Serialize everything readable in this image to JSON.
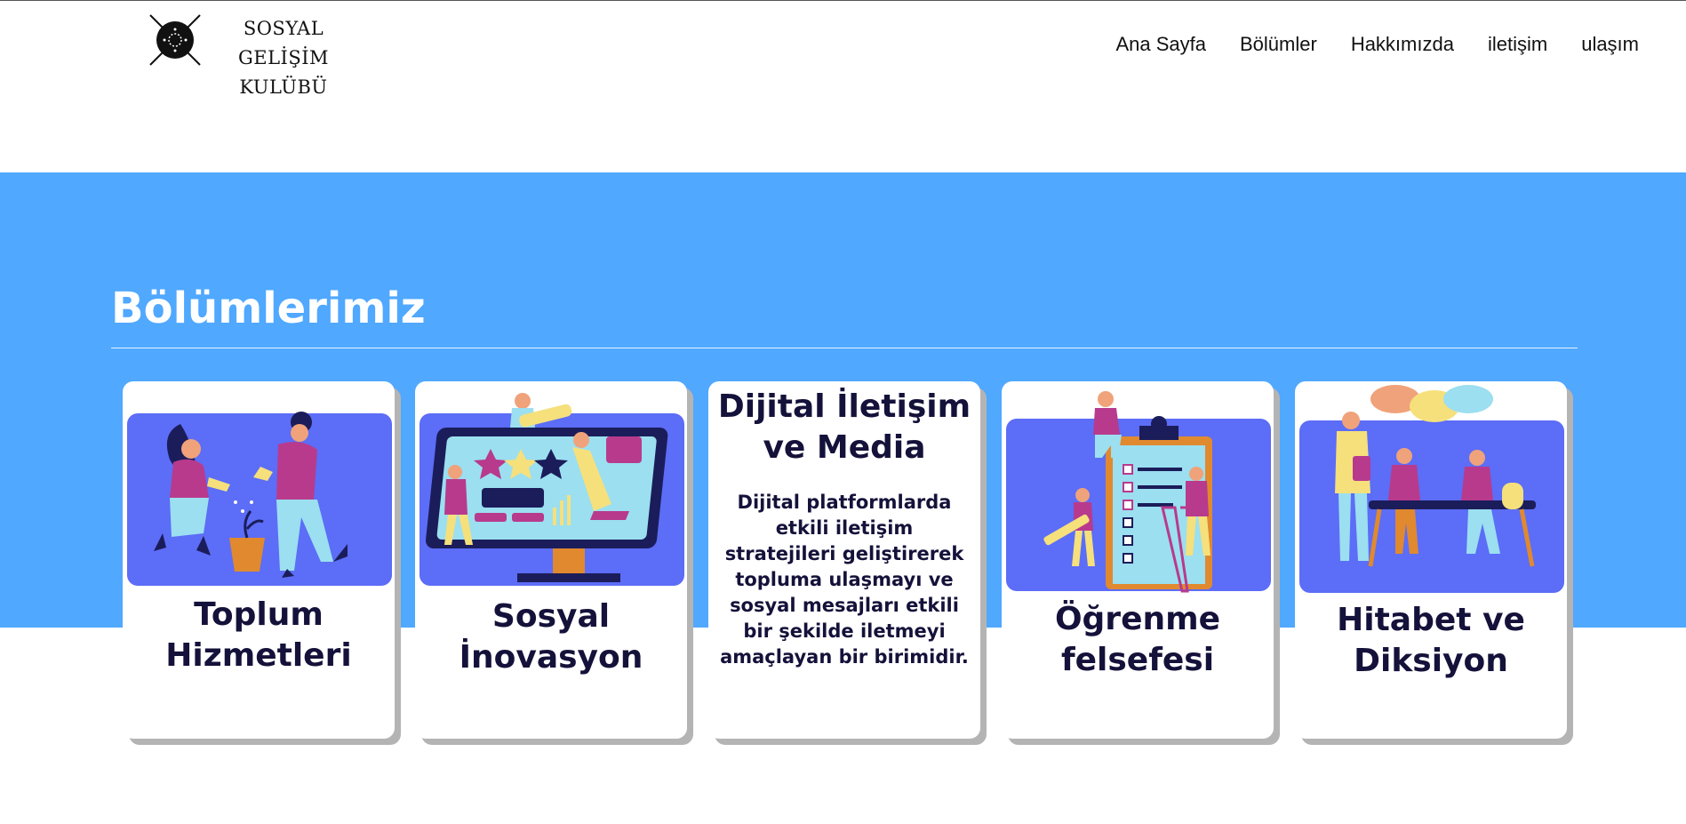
{
  "header": {
    "logo": {
      "line1": "SOSYAL GELİŞİM",
      "line2": "KULÜBÜ"
    },
    "nav": [
      "Ana Sayfa",
      "Bölümler",
      "Hakkımızda",
      "iletişim",
      "ulaşım"
    ]
  },
  "section": {
    "title": "Bölümlerimiz"
  },
  "cards": [
    {
      "title": "Toplum Hizmetleri",
      "icon": "community-service-illustration"
    },
    {
      "title": "Sosyal İnovasyon",
      "icon": "social-innovation-illustration"
    },
    {
      "title": "Dijital İletişim ve Media",
      "description": "Dijital platformlarda etkili iletişim stratejileri geliştirerek topluma ulaşmayı ve sosyal mesajları etkili bir şekilde iletmeyi amaçlayan bir birimidir."
    },
    {
      "title": "Öğrenme felsefesi",
      "icon": "learning-checklist-illustration"
    },
    {
      "title": "Hitabet ve Diksiyon",
      "icon": "speech-discussion-illustration"
    }
  ],
  "colors": {
    "band": "#50a8ff",
    "art_bg": "#5c6df7",
    "title_text": "#14123a"
  }
}
